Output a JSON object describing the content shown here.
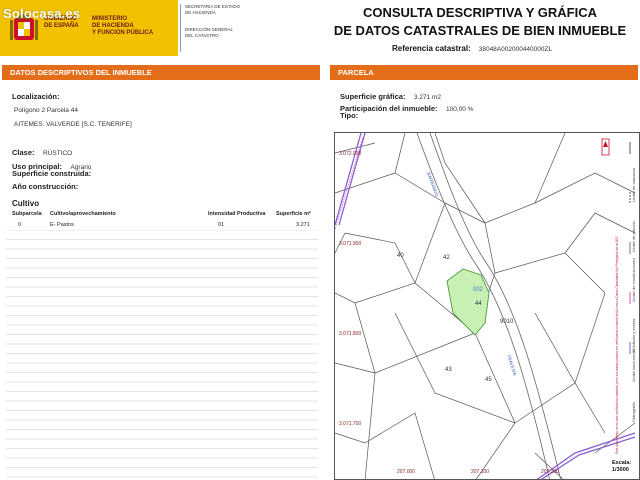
{
  "header": {
    "watermark": "Solocasa.es",
    "gov_line1": "GOBIERNO",
    "gov_line2": "DE ESPAÑA",
    "ministry_line1": "MINISTERIO",
    "ministry_line2": "DE HACIENDA",
    "ministry_line3": "Y FUNCIÓN PÚBLICA",
    "sec_line1": "SECRETARÍA DE ESTADO",
    "sec_line2": "DE HACIENDA",
    "dir_line1": "DIRECCIÓN GENERAL",
    "dir_line2": "DEL CATASTRO",
    "title_line1": "CONSULTA DESCRIPTIVA Y GRÁFICA",
    "title_line2": "DE DATOS CATASTRALES DE BIEN INMUEBLE",
    "ref_label": "Referencia catastral:",
    "ref_value": "38048A002000440000ZL"
  },
  "left": {
    "bar_label": "DATOS DESCRIPTIVOS DEL INMUEBLE",
    "localizacion_label": "Localización:",
    "localizacion_line1": "Polígono 2 Parcela 44",
    "localizacion_line2": "AITEMES. VALVERDE [S.C. TENERIFE]",
    "clase_label": "Clase:",
    "clase_value": "RÚSTICO",
    "uso_label": "Uso principal:",
    "uso_value": "Agrario",
    "superficie_label": "Superficie construida:",
    "anio_label": "Año construcción:",
    "cultivo_label": "Cultivo",
    "table_headers": [
      "Subparcela",
      "Cultivo/aprovechamiento",
      "Intensidad Productiva",
      "Superficie m²"
    ],
    "table_rows": [
      [
        "0",
        "E- Pastos",
        "01",
        "3.271"
      ]
    ]
  },
  "right": {
    "bar_label": "PARCELA",
    "superficie_grafica_label": "Superficie gráfica:",
    "superficie_grafica_value": "3.271 m2",
    "participacion_label": "Participación del inmueble:",
    "participacion_value": "100,00 %",
    "tipo_label": "Tipo:",
    "map": {
      "y_labels": [
        "3.072.000",
        "3.071.900",
        "3.071.800",
        "3.071.700"
      ],
      "x_labels": [
        "207.000",
        "207.100",
        "207.200"
      ],
      "parcel_labels": [
        "40",
        "42",
        "43",
        "45",
        "44",
        "002",
        "9010"
      ],
      "road_labels": [
        "BARRANCO",
        "TRAVESÍA"
      ],
      "highlight_color": "#c8f0b4",
      "legend_items": [
        "Límite de manzana",
        "Límite de parcela",
        "Límite de construcciones",
        "Mobiliario y aceras",
        "Límite zona verde",
        "Hidrografía"
      ],
      "legend_note": "Este documento no es una certificación catastral, pero sus datos pueden ser verificados a través del Acceso a Datos Catastrales No Protegidos de la SEC",
      "scale_label": "Escala:",
      "scale_value": "1/3000"
    }
  }
}
